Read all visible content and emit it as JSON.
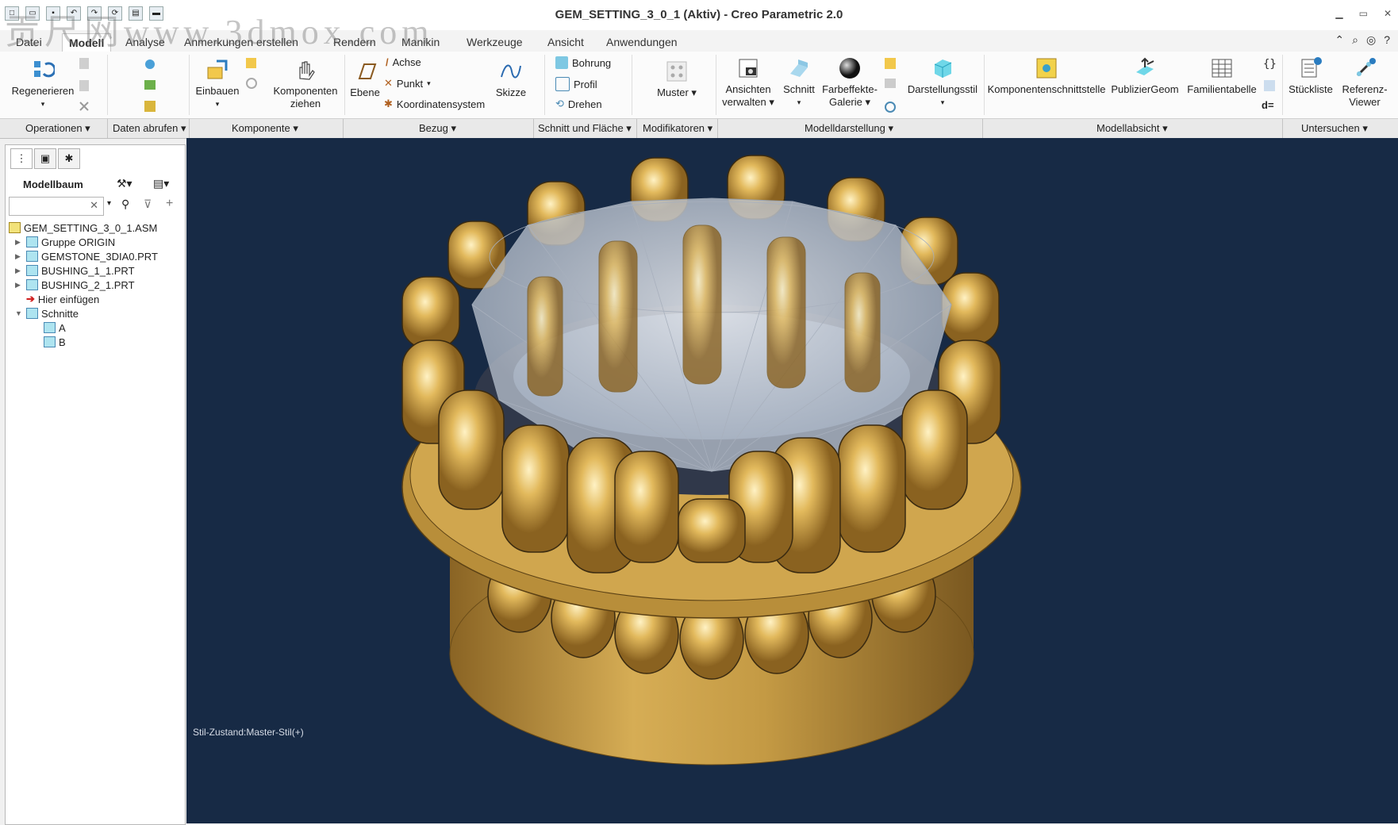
{
  "window": {
    "title": "GEM_SETTING_3_0_1 (Aktiv) - Creo Parametric 2.0"
  },
  "watermark": "贡尺网www.3dmox.com",
  "menu": {
    "tabs": [
      "Datei",
      "Modell",
      "Analyse",
      "Anmerkungen erstellen",
      "Rendern",
      "Manikin",
      "Werkzeuge",
      "Ansicht",
      "Anwendungen"
    ],
    "active": "Modell"
  },
  "ribbon": {
    "regenerieren": "Regenerieren",
    "einbauen": "Einbauen",
    "komponenten_ziehen_1": "Komponenten",
    "komponenten_ziehen_2": "ziehen",
    "ebene": "Ebene",
    "achse": "Achse",
    "punkt": "Punkt",
    "koordinatensystem": "Koordinatensystem",
    "skizze": "Skizze",
    "bohrung": "Bohrung",
    "profil": "Profil",
    "drehen": "Drehen",
    "muster": "Muster",
    "ansichten_1": "Ansichten",
    "ansichten_2": "verwalten",
    "schnitt": "Schnitt",
    "farbeffekte_1": "Farbeffekte-",
    "farbeffekte_2": "Galerie",
    "darstellungsstil": "Darstellungsstil",
    "komponentenschnittstelle": "Komponentenschnittstelle",
    "publiziergeom": "PublizierGeom",
    "familientabelle": "Familientabelle",
    "stueckliste": "Stückliste",
    "referenz_1": "Referenz-",
    "referenz_2": "Viewer",
    "d_equals": "d="
  },
  "groups": [
    "Operationen",
    "Daten abrufen",
    "Komponente",
    "Bezug",
    "Schnitt und Fläche",
    "Modifikatoren",
    "Modelldarstellung",
    "Modellabsicht",
    "Untersuchen"
  ],
  "panel": {
    "title": "Modellbaum",
    "tree": [
      {
        "label": "GEM_SETTING_3_0_1.ASM"
      },
      {
        "label": "Gruppe ORIGIN"
      },
      {
        "label": "GEMSTONE_3DIA0.PRT"
      },
      {
        "label": "BUSHING_1_1.PRT"
      },
      {
        "label": "BUSHING_2_1.PRT"
      },
      {
        "label": "Hier einfügen"
      },
      {
        "label": "Schnitte"
      },
      {
        "label": "A"
      },
      {
        "label": "B"
      }
    ]
  },
  "viewport": {
    "status": "Stil-Zustand:Master-Stil(+)"
  },
  "colors": {
    "viewport_bg": "#172a45",
    "gold": "#c9a046",
    "gem": "#e6e9ee"
  }
}
